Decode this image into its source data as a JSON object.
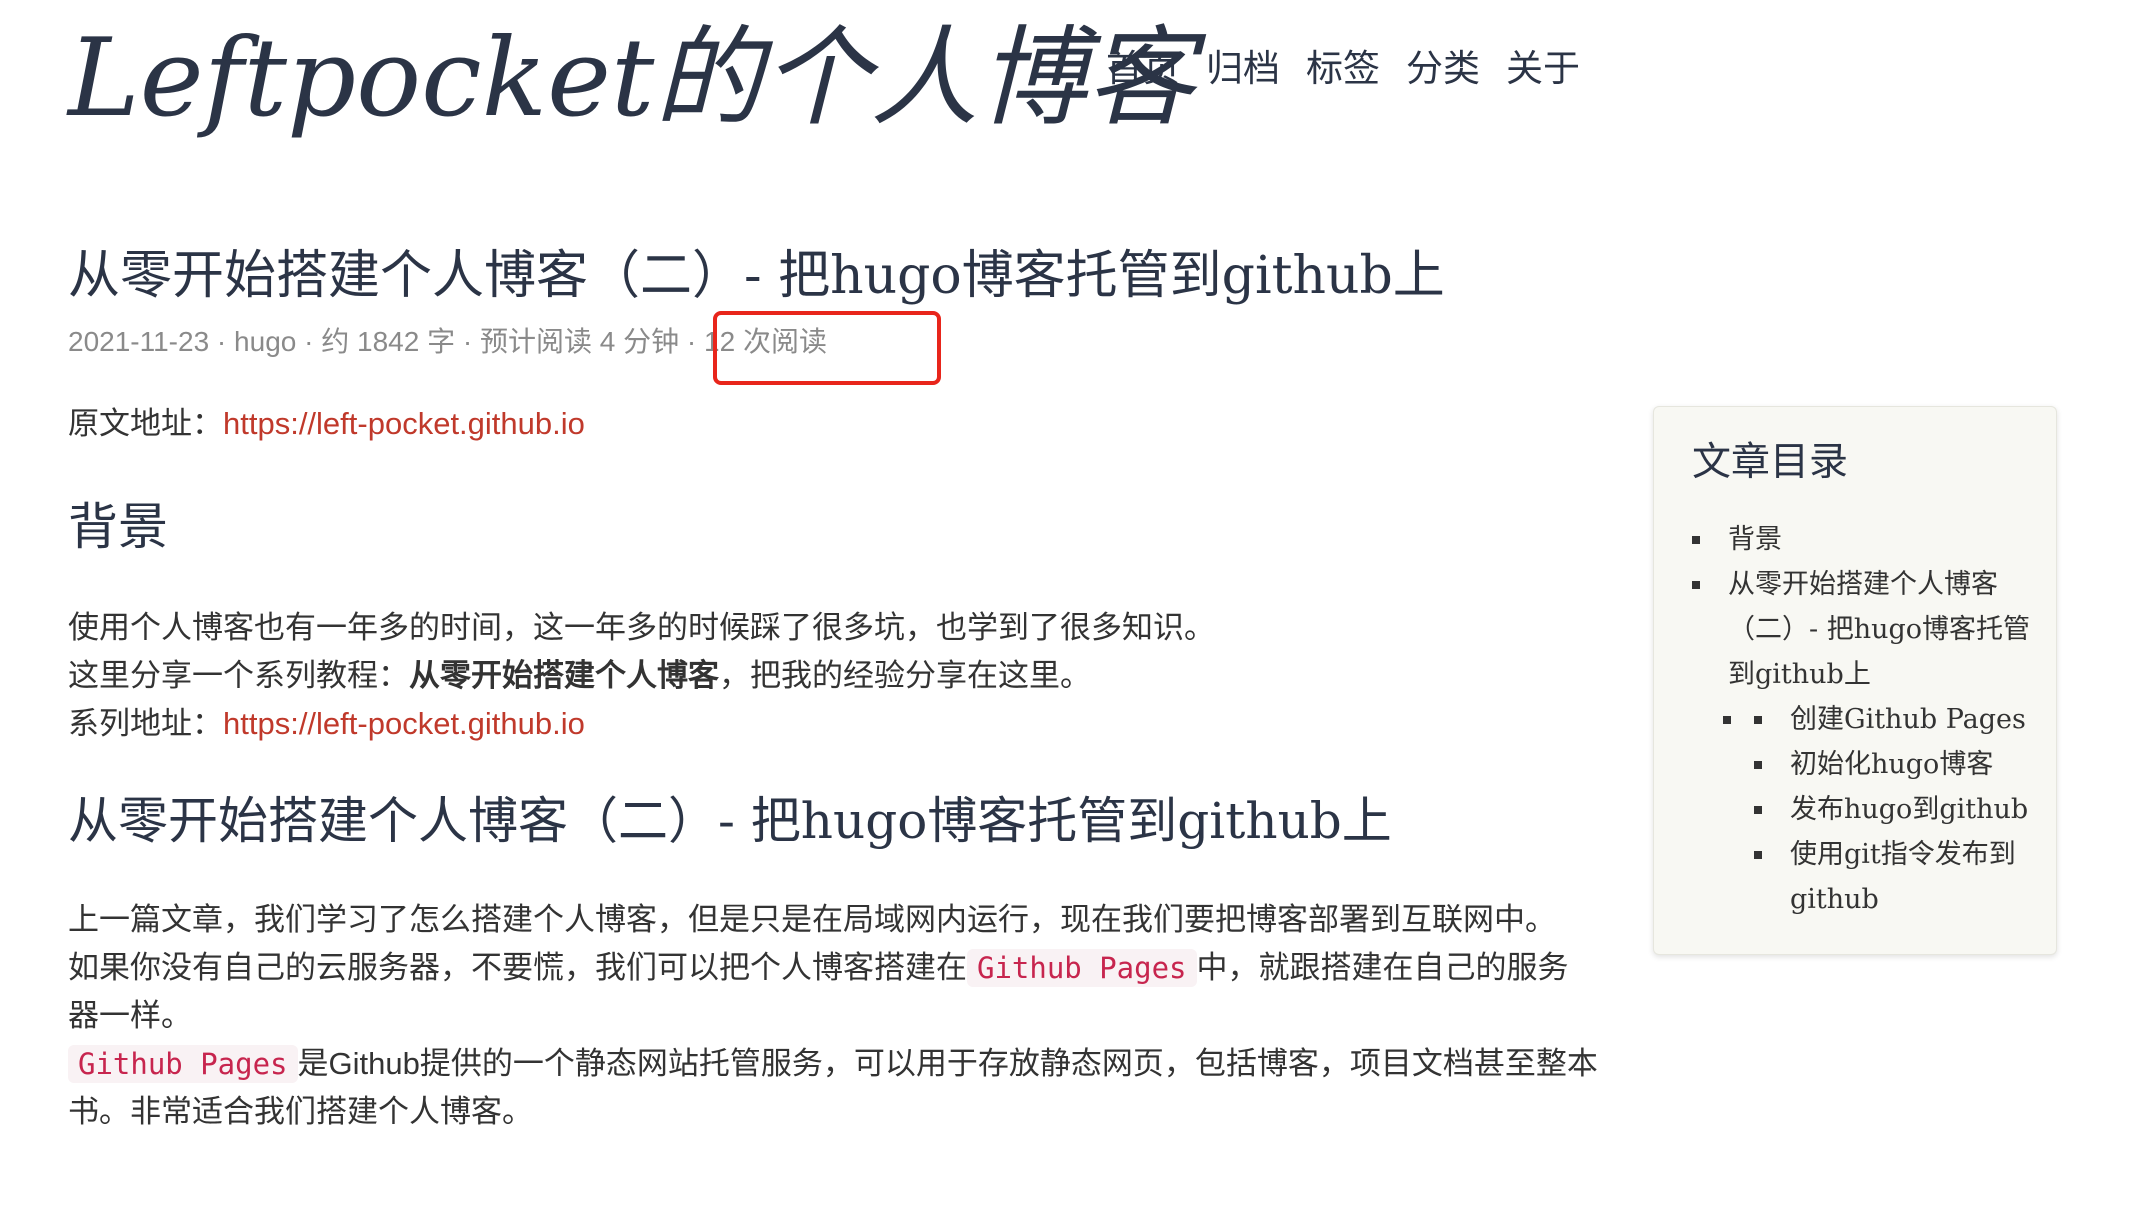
{
  "header": {
    "logo": "Leftpocket的个人博客",
    "nav": [
      "首页",
      "归档",
      "标签",
      "分类",
      "关于"
    ]
  },
  "post": {
    "title": "从零开始搭建个人博客（二）- 把hugo博客托管到github上",
    "meta": {
      "date": "2021-11-23",
      "author": "hugo",
      "word_count": "约 1842 字",
      "read_time": "预计阅读 4 分钟",
      "views": "12 次阅读"
    },
    "source_label": "原文地址：",
    "source_url": "https://left-pocket.github.io",
    "sections": {
      "background_heading": "背景",
      "bg_p1": "使用个人博客也有一年多的时间，这一年多的时候踩了很多坑，也学到了很多知识。",
      "bg_p2_prefix": "这里分享一个系列教程：",
      "bg_p2_bold": "从零开始搭建个人博客",
      "bg_p2_suffix": "，把我的经验分享在这里。",
      "series_label": "系列地址：",
      "series_url": "https://left-pocket.github.io",
      "main_heading": "从零开始搭建个人博客（二）- 把hugo博客托管到github上",
      "main_p1": "上一篇文章，我们学习了怎么搭建个人博客，但是只是在局域网内运行，现在我们要把博客部署到互联网中。",
      "main_p2_prefix": "如果你没有自己的云服务器，不要慌，我们可以把个人博客搭建在",
      "main_p2_code": "Github Pages",
      "main_p2_suffix": "中，就跟搭建在自己的服务器一样。",
      "main_p3_code": "Github Pages",
      "main_p3_suffix": "是Github提供的一个静态网站托管服务，可以用于存放静态网页，包括博客，项目文档甚至整本书。非常适合我们搭建个人博客。"
    }
  },
  "toc": {
    "title": "文章目录",
    "items": [
      "背景",
      "从零开始搭建个人博客（二）- 把hugo博客托管到github上"
    ],
    "sub_items": [
      "创建Github Pages",
      "初始化hugo博客",
      "发布hugo到github",
      "使用git指令发布到github"
    ]
  },
  "colors": {
    "highlight": "#e8251b",
    "link": "#c0392b",
    "code_text": "#c7254e",
    "code_bg": "#f9f2f4",
    "heading": "#2b3446"
  }
}
